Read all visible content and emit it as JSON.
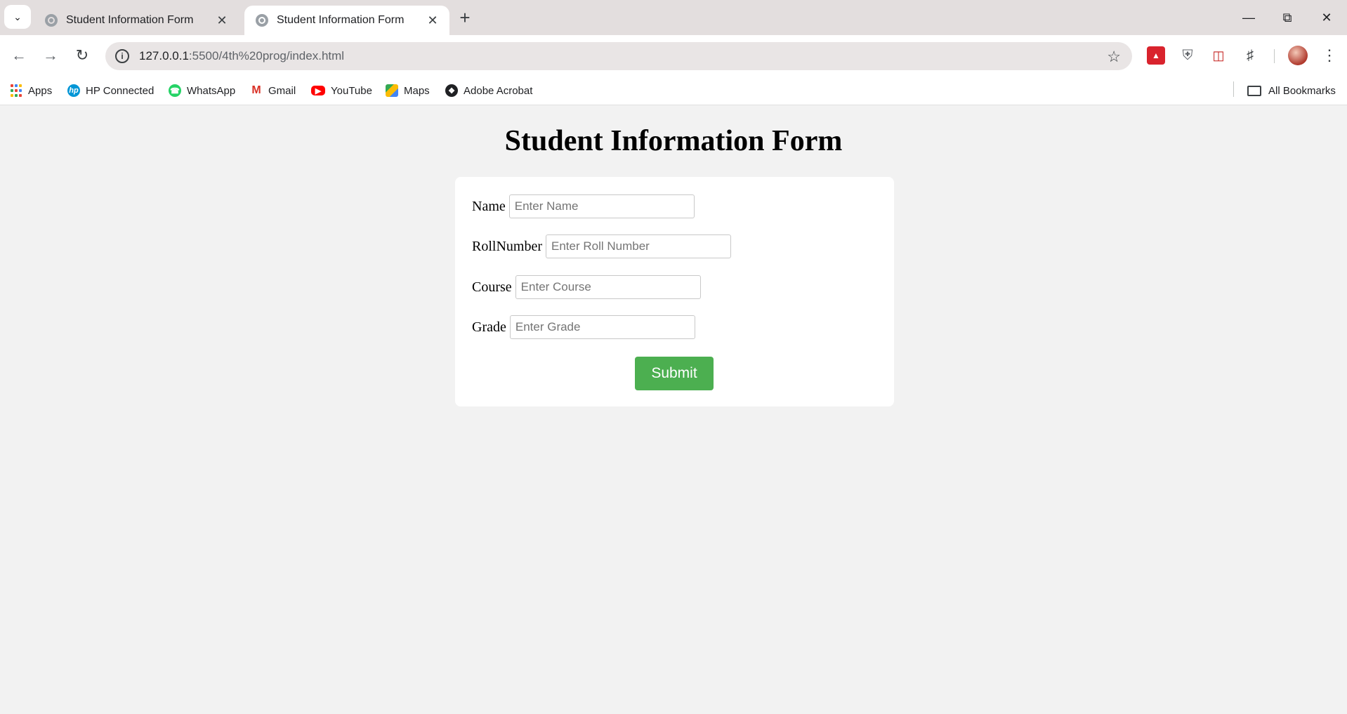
{
  "browser": {
    "tabs": [
      {
        "title": "Student Information Form",
        "active": false
      },
      {
        "title": "Student Information Form",
        "active": true
      }
    ],
    "new_tab_label": "+",
    "url_host": "127.0.0.1",
    "url_path": ":5500/4th%20prog/index.html",
    "bookmarks": [
      {
        "label": "Apps",
        "icon": "apps-grid-icon"
      },
      {
        "label": "HP Connected",
        "icon": "hp-icon"
      },
      {
        "label": "WhatsApp",
        "icon": "whatsapp-icon"
      },
      {
        "label": "Gmail",
        "icon": "gmail-icon"
      },
      {
        "label": "YouTube",
        "icon": "youtube-icon"
      },
      {
        "label": "Maps",
        "icon": "maps-icon"
      },
      {
        "label": "Adobe Acrobat",
        "icon": "adobe-acrobat-icon"
      }
    ],
    "all_bookmarks_label": "All Bookmarks"
  },
  "page": {
    "title": "Student Information Form",
    "fields": [
      {
        "label": "Name",
        "placeholder": "Enter Name",
        "value": ""
      },
      {
        "label": "RollNumber",
        "placeholder": "Enter Roll Number",
        "value": ""
      },
      {
        "label": "Course",
        "placeholder": "Enter Course",
        "value": ""
      },
      {
        "label": "Grade",
        "placeholder": "Enter Grade",
        "value": ""
      }
    ],
    "submit_label": "Submit"
  },
  "colors": {
    "submit_button": "#4caf50",
    "page_background": "#f2f2f2",
    "tabstrip_background": "#e3dede"
  }
}
